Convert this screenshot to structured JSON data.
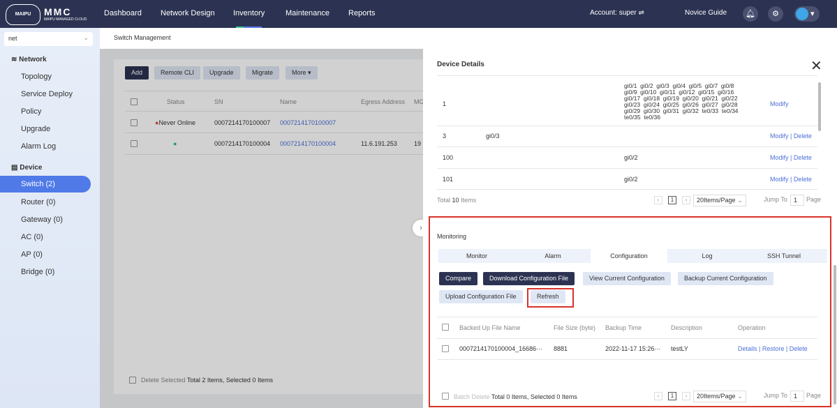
{
  "header": {
    "logo_text": "MAIPU",
    "logo_tagline": "MAKE IT INTELLIGENT",
    "brand": "MMC",
    "brand_sub": "MAIPU MANAGED CLOUD",
    "nav": [
      "Dashboard",
      "Network Design",
      "Inventory",
      "Maintenance",
      "Reports"
    ],
    "active_nav": "Inventory",
    "account": "Account: super ⇌",
    "novice_guide": "Novice Guide",
    "accent": "#2c3352"
  },
  "sidebar": {
    "site_select": "net",
    "network_label": "Network",
    "network_items": [
      "Topology",
      "Service Deploy",
      "Policy",
      "Upgrade",
      "Alarm Log"
    ],
    "device_label": "Device",
    "device_items": [
      "Switch (2)",
      "Router (0)",
      "Gateway (0)",
      "AC (0)",
      "AP (0)",
      "Bridge (0)"
    ],
    "active": "Switch (2)"
  },
  "breadcrumb": "Switch Management",
  "switch_list": {
    "buttons": [
      "Add",
      "Remote CLI",
      "Upgrade",
      "Migrate",
      "More ▾"
    ],
    "columns": [
      "Status",
      "SN",
      "Name",
      "Egress Address",
      "MG"
    ],
    "rows": [
      {
        "status": "Never Online",
        "sn": "0007214170100007",
        "name": "0007214170100007",
        "egress": "",
        "mg": ""
      },
      {
        "status": "",
        "sn": "0007214170100004",
        "name": "0007214170100004",
        "egress": "11.6.191.253",
        "mg": "19"
      }
    ],
    "footer_delete": "Delete Selected",
    "footer_total": "Total 2 Items, Selected 0 Items"
  },
  "drawer": {
    "title": "Device Details",
    "vlan_rows": [
      {
        "id": "1",
        "a": "",
        "b": "gi0/1  gi0/2  gi0/3  gi0/4  gi0/5  gi0/7  gi0/8\ngi0/9  gi0/10  gi0/11  gi0/12  gi0/15  gi0/16\ngi0/17  gi0/18  gi0/19  gi0/20  gi0/21  gi0/22\ngi0/23  gi0/24  gi0/25  gi0/26  gi0/27  gi0/28\ngi0/29  gi0/30  gi0/31  gi0/32  te0/33  te0/34\nte0/35  te0/36",
        "ops": [
          "Modify"
        ]
      },
      {
        "id": "3",
        "a": "gi0/3",
        "b": "",
        "ops": [
          "Modify",
          "Delete"
        ]
      },
      {
        "id": "100",
        "a": "",
        "b": "gi0/2",
        "ops": [
          "Modify",
          "Delete"
        ]
      },
      {
        "id": "101",
        "a": "",
        "b": "gi0/2",
        "ops": [
          "Modify",
          "Delete"
        ]
      }
    ],
    "vlan_total_prefix": "Total",
    "vlan_total": "10",
    "vlan_total_suffix": "Items",
    "page": "1",
    "page_size": "20Items/Page",
    "jump_to": "Jump To",
    "jump_value": "1",
    "page_word": "Page",
    "monitoring": "Monitoring",
    "tabs": [
      "Monitor",
      "Alarm",
      "Configuration",
      "Log",
      "SSH Tunnel"
    ],
    "active_tab": "Configuration",
    "config_buttons": [
      "Compare",
      "Download Configuration File",
      "View Current Configuration",
      "Backup Current Configuration",
      "Upload Configuration File",
      "Refresh"
    ],
    "columns": [
      "Backed Up File Name",
      "File Size (byte)",
      "Backup Time",
      "Description",
      "Operation"
    ],
    "rows": [
      {
        "file": "0007214170100004_16686···",
        "size": "8881",
        "time": "2022-11-17 15:26···",
        "desc": "testLY",
        "ops": [
          "Details",
          "Restore",
          "Delete"
        ]
      }
    ],
    "batch_delete": "Batch Delete",
    "footer_total": "Total 0 Items, Selected 0 Items"
  }
}
